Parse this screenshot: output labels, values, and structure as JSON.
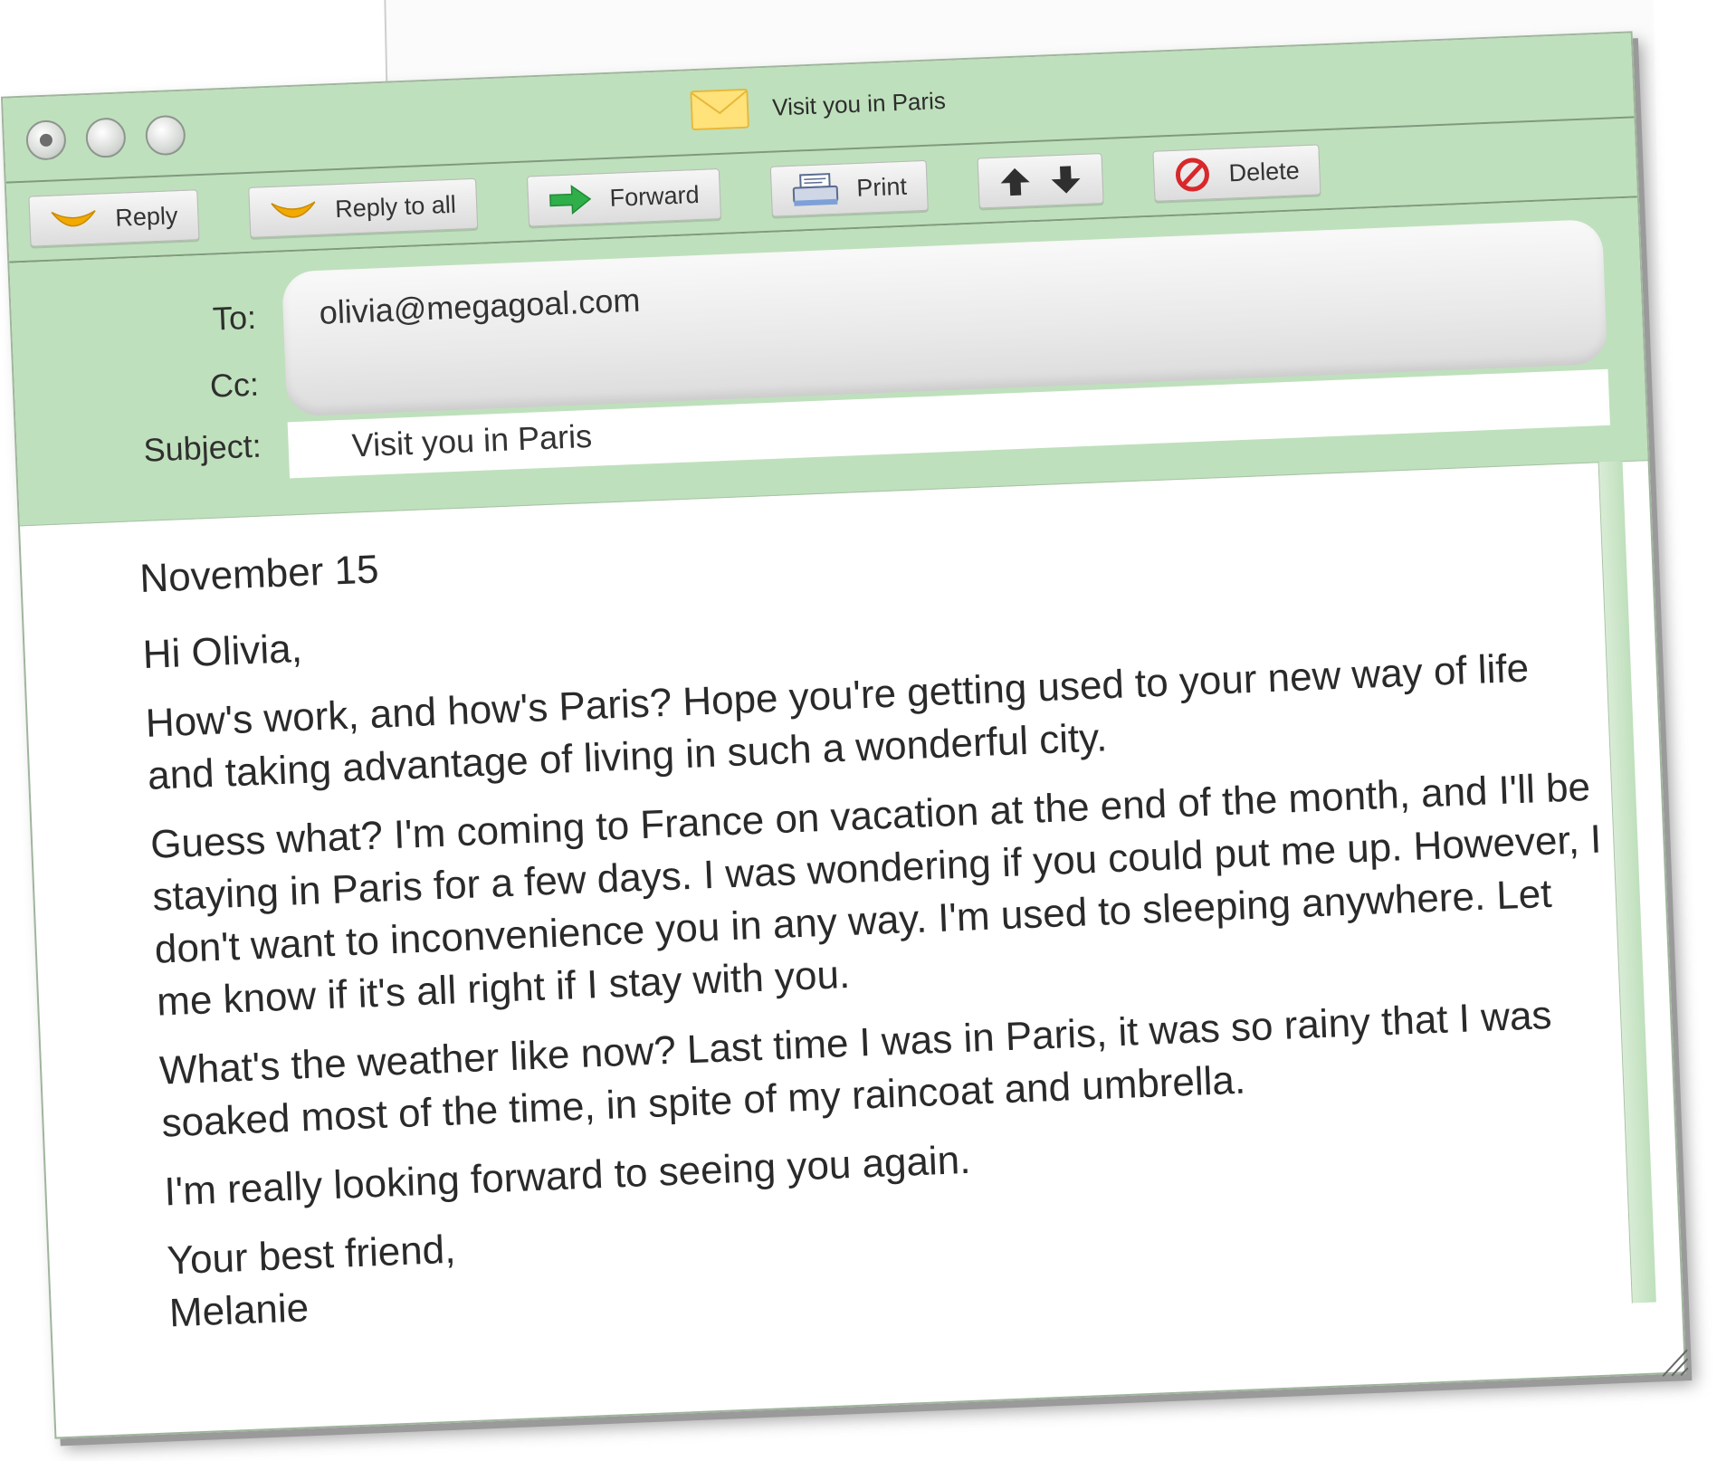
{
  "window": {
    "title": "Visit you in Paris"
  },
  "toolbar": {
    "reply": "Reply",
    "reply_all": "Reply to all",
    "forward": "Forward",
    "print": "Print",
    "delete": "Delete"
  },
  "header": {
    "to_label": "To:",
    "to_value": "olivia@megagoal.com",
    "cc_label": "Cc:",
    "subject_label": "Subject:",
    "subject_value": "Visit you in Paris"
  },
  "body": {
    "date": "November 15",
    "greeting": "Hi Olivia,",
    "p1": "How's work, and how's Paris? Hope you're getting used to your new way of life and taking advantage of living in such a wonderful city.",
    "p2": "Guess what? I'm coming to France on vacation at the end of the month, and I'll be staying in Paris for a few days. I was wondering if you could put me up. However, I don't want to inconvenience you in any way. I'm used to sleeping anywhere. Let me know if it's all right if I stay with you.",
    "p3": "What's the weather like now? Last time I was in Paris, it was so rainy that I was soaked most of the time, in spite of my raincoat and umbrella.",
    "p4": "I'm really looking forward to seeing you again.",
    "closing": "Your best friend,",
    "signature": "Melanie"
  },
  "colors": {
    "chrome_green": "#bfe0bc",
    "forward_green": "#2fae4a",
    "reply_orange": "#f2a900",
    "delete_red": "#d8282b"
  },
  "icons": {
    "reply": "reply-arrow-icon",
    "reply_all": "reply-all-arrow-icon",
    "forward": "forward-arrow-icon",
    "print": "printer-icon",
    "prev": "arrow-up-icon",
    "next": "arrow-down-icon",
    "delete": "no-entry-icon",
    "title": "envelope-icon"
  }
}
